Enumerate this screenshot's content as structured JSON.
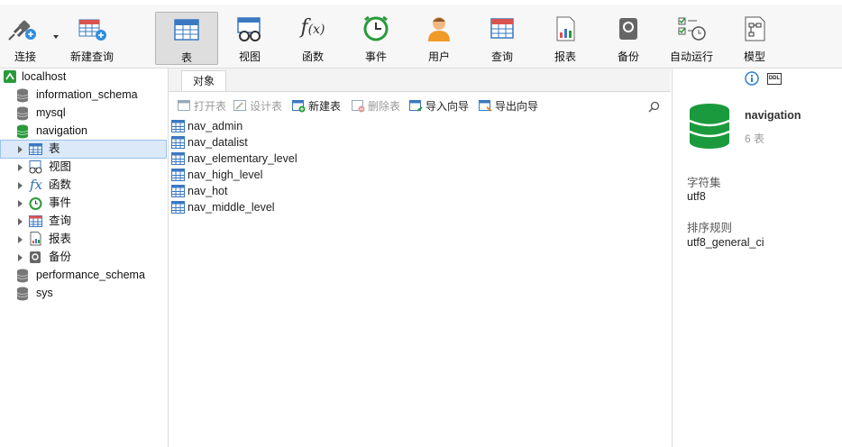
{
  "toolbar": {
    "buttons": [
      {
        "label": "连接"
      },
      {
        "label": "新建查询"
      },
      {
        "label": "表"
      },
      {
        "label": "视图"
      },
      {
        "label": "函数"
      },
      {
        "label": "事件"
      },
      {
        "label": "用户"
      },
      {
        "label": "查询"
      },
      {
        "label": "报表"
      },
      {
        "label": "备份"
      },
      {
        "label": "自动运行"
      },
      {
        "label": "模型"
      }
    ]
  },
  "tree": {
    "connection": "localhost",
    "databases": [
      "information_schema",
      "mysql",
      "navigation"
    ],
    "children": [
      "表",
      "视图",
      "函数",
      "事件",
      "查询",
      "报表",
      "备份"
    ],
    "after": [
      "performance_schema",
      "sys"
    ]
  },
  "center": {
    "tab": "对象",
    "actions": [
      "打开表",
      "设计表",
      "新建表",
      "删除表",
      "导入向导",
      "导出向导"
    ],
    "tables": [
      "nav_admin",
      "nav_datalist",
      "nav_elementary_level",
      "nav_high_level",
      "nav_hot",
      "nav_middle_level"
    ]
  },
  "info": {
    "db_name": "navigation",
    "table_count": "6 表",
    "charset_label": "字符集",
    "charset": "utf8",
    "collation_label": "排序规则",
    "collation": "utf8_general_ci"
  },
  "colors": {
    "accent": "#1a9a3c",
    "selection": "#dbe9f9",
    "table_icon": "#3a78c2"
  }
}
